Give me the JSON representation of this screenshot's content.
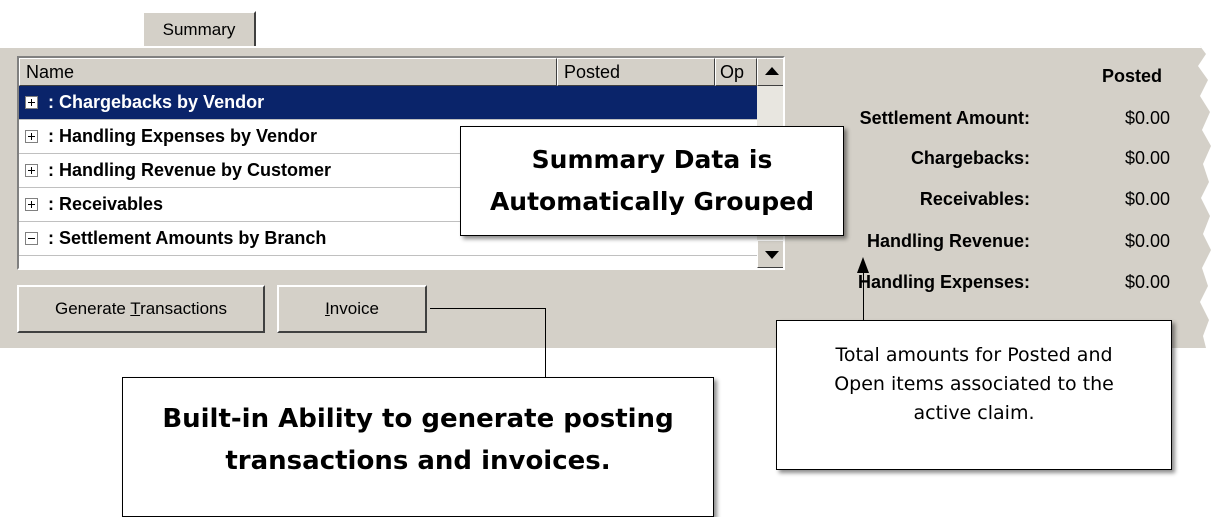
{
  "tabs": [
    {
      "label": "Summary"
    }
  ],
  "grid": {
    "columns": [
      "Name",
      "Posted",
      "Op"
    ],
    "rows": [
      {
        "label": ": Chargebacks by Vendor",
        "expander": "+",
        "selected": true
      },
      {
        "label": ": Handling Expenses by Vendor",
        "expander": "+",
        "selected": false
      },
      {
        "label": ": Handling Revenue by Customer",
        "expander": "+",
        "selected": false
      },
      {
        "label": ": Receivables",
        "expander": "+",
        "selected": false
      },
      {
        "label": ": Settlement Amounts by Branch",
        "expander": "-",
        "selected": false
      }
    ]
  },
  "buttons": {
    "generate": {
      "pre": "Generate ",
      "accel": "T",
      "post": "ransactions"
    },
    "invoice": {
      "pre": "",
      "accel": "I",
      "post": "nvoice"
    }
  },
  "totals": {
    "header": "Posted",
    "lines": [
      {
        "label": "Settlement Amount:",
        "value": "$0.00"
      },
      {
        "label": "Chargebacks:",
        "value": "$0.00"
      },
      {
        "label": "Receivables:",
        "value": "$0.00"
      },
      {
        "label": "Handling Revenue:",
        "value": "$0.00"
      },
      {
        "label": "Handling Expenses:",
        "value": "$0.00"
      }
    ]
  },
  "callouts": {
    "grouped": [
      "Summary Data is",
      "Automatically Grouped"
    ],
    "generate": [
      "Built-in Ability to generate posting",
      "transactions and invoices."
    ],
    "totals": [
      "Total amounts for Posted and",
      "Open items associated to the",
      "active claim."
    ]
  },
  "colors": {
    "selection": "#0a246a",
    "panel": "#d4d0c8"
  }
}
